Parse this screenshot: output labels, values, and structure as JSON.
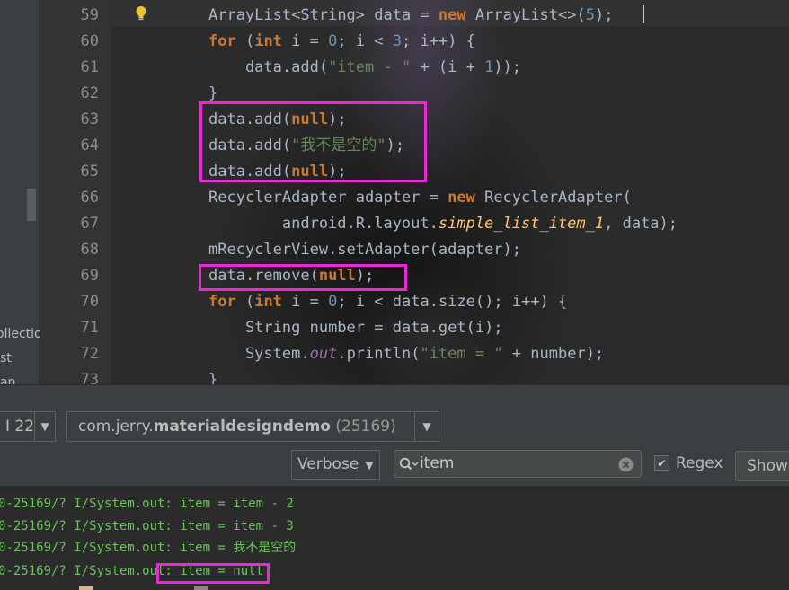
{
  "project_panel": {
    "items": [
      "ollectio",
      "st",
      "an"
    ]
  },
  "editor": {
    "lines": [
      {
        "num": "59",
        "segments": [
          [
            "typ",
            "ArrayList"
          ],
          [
            "",
            "<"
          ],
          [
            "typ",
            "String"
          ],
          [
            "",
            "> data = "
          ],
          [
            "kw",
            "new"
          ],
          [
            "typ",
            " ArrayList"
          ],
          [
            "",
            "<>("
          ],
          [
            "num",
            "5"
          ],
          [
            "",
            ");"
          ]
        ]
      },
      {
        "num": "60",
        "segments": [
          [
            "kw",
            "for"
          ],
          [
            "",
            " ("
          ],
          [
            "kw",
            "int"
          ],
          [
            "",
            " i = "
          ],
          [
            "num",
            "0"
          ],
          [
            "",
            "; i < "
          ],
          [
            "num",
            "3"
          ],
          [
            "",
            "; i++) {"
          ]
        ]
      },
      {
        "num": "61",
        "segments": [
          [
            "",
            "    data.add("
          ],
          [
            "str",
            "\"item - \""
          ],
          [
            "",
            " + (i + "
          ],
          [
            "num",
            "1"
          ],
          [
            "",
            "));"
          ]
        ]
      },
      {
        "num": "62",
        "segments": [
          [
            "",
            "}"
          ]
        ]
      },
      {
        "num": "63",
        "segments": [
          [
            "",
            "data.add("
          ],
          [
            "kw",
            "null"
          ],
          [
            "",
            ");"
          ]
        ]
      },
      {
        "num": "64",
        "segments": [
          [
            "",
            "data.add("
          ],
          [
            "str",
            "\"我不是空的\""
          ],
          [
            "",
            ");"
          ]
        ]
      },
      {
        "num": "65",
        "segments": [
          [
            "",
            "data.add("
          ],
          [
            "kw",
            "null"
          ],
          [
            "",
            ");"
          ]
        ]
      },
      {
        "num": "66",
        "segments": [
          [
            "typ",
            "RecyclerAdapter"
          ],
          [
            "",
            " adapter = "
          ],
          [
            "kw",
            "new"
          ],
          [
            "typ",
            " RecyclerAdapter"
          ],
          [
            "",
            "("
          ]
        ]
      },
      {
        "num": "67",
        "segments": [
          [
            "",
            "        android.R.layout."
          ],
          [
            "itf",
            "simple_list_item_1"
          ],
          [
            "",
            ", data);"
          ]
        ]
      },
      {
        "num": "68",
        "segments": [
          [
            "fld2",
            "mRecyclerView"
          ],
          [
            "",
            ".setAdapter(adapter);"
          ]
        ]
      },
      {
        "num": "69",
        "segments": [
          [
            "",
            "data.remove("
          ],
          [
            "kw",
            "null"
          ],
          [
            "",
            ");"
          ]
        ]
      },
      {
        "num": "70",
        "segments": [
          [
            "kw",
            "for"
          ],
          [
            "",
            " ("
          ],
          [
            "kw",
            "int"
          ],
          [
            "",
            " i = "
          ],
          [
            "num",
            "0"
          ],
          [
            "",
            "; i < data.size(); i++) {"
          ]
        ]
      },
      {
        "num": "71",
        "segments": [
          [
            "typ",
            "    String"
          ],
          [
            "",
            " number = data.get(i);"
          ]
        ]
      },
      {
        "num": "72",
        "segments": [
          [
            "typ",
            "    System"
          ],
          [
            "",
            "."
          ],
          [
            "fld",
            "out"
          ],
          [
            "",
            ".println("
          ],
          [
            "str",
            "\"item = \""
          ],
          [
            "",
            " + number);"
          ]
        ]
      },
      {
        "num": "73",
        "segments": [
          [
            "",
            "}"
          ]
        ]
      }
    ]
  },
  "logcat": {
    "device_label": "I 22",
    "process_prefix": "com.jerry.",
    "process_bold": "materialdesigndemo",
    "process_pid": " (25169)",
    "log_level": "Verbose",
    "search_value": "item",
    "regex_label": "Regex",
    "regex_checked": true,
    "show_label": "Show",
    "lines": [
      "0-25169/? I/System.out: item = item - 2",
      "0-25169/? I/System.out: item = item - 3",
      "0-25169/? I/System.out: item = 我不是空的",
      "0-25169/? I/System.out: item = null"
    ]
  },
  "colors": {
    "highlight_box": "#e62ad8",
    "keyword": "#cc7832",
    "string": "#6a8759",
    "number": "#6897bb",
    "log_text": "#6ac25a"
  }
}
